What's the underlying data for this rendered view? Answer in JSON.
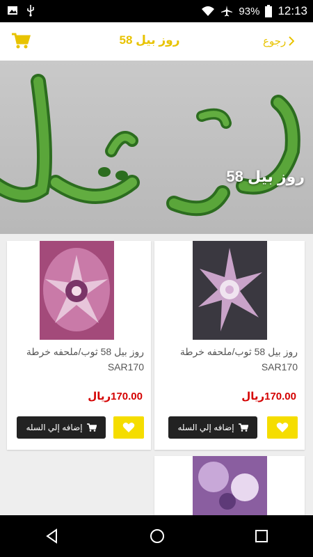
{
  "status_bar": {
    "battery": "93%",
    "time": "12:13",
    "icons": [
      "image-icon",
      "usb-icon",
      "wifi-icon",
      "airplane-icon",
      "battery-icon"
    ]
  },
  "header": {
    "back_label": "رجوع",
    "title": "روز بيل 58",
    "accent_color": "#e8c300"
  },
  "banner": {
    "text": "روز بيل 58"
  },
  "products": [
    {
      "name": "روز بيل 58 ثوب/ملحفه خرطة SAR170",
      "price": "170.00ريال",
      "add_label": "إضافه إلي السله"
    },
    {
      "name": "روز بيل 58 ثوب/ملحفه خرطة SAR170",
      "price": "170.00ريال",
      "add_label": "إضافه إلي السله"
    }
  ],
  "colors": {
    "price": "#d40000",
    "fav_button": "#f5dd00",
    "add_button": "#222222"
  }
}
